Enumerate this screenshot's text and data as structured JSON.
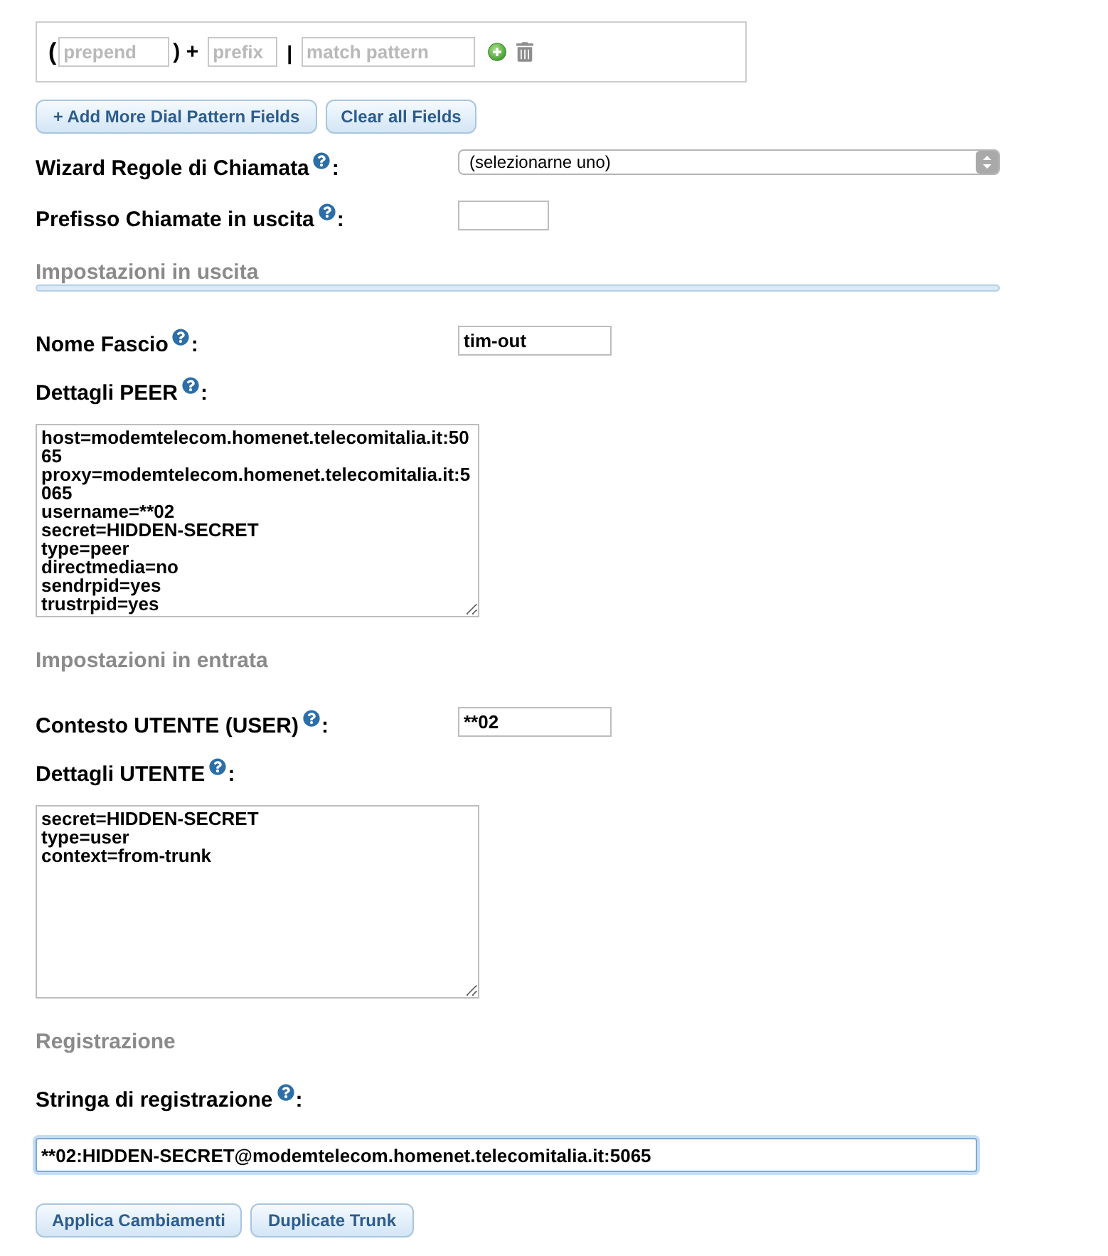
{
  "dial_pattern": {
    "open": "(",
    "prepend": {
      "placeholder": "prepend"
    },
    "plus": ") +",
    "prefix": {
      "placeholder": "prefix"
    },
    "separator": "|",
    "match": {
      "placeholder": "match pattern"
    }
  },
  "pattern_buttons": [
    "+ Add More Dial Pattern Fields",
    "Clear all Fields"
  ],
  "rows": [
    {
      "kind": "select",
      "label": "Wizard Regole di Chiamata",
      "colon": ":",
      "value": "(selezionarne uno)"
    },
    {
      "kind": "input",
      "label": "Prefisso Chiamate in uscita",
      "colon": ":",
      "focused": false
    },
    {
      "kind": "section",
      "title": "Impostazioni in uscita",
      "rule": true
    },
    {
      "kind": "input",
      "label": "Nome Fascio",
      "colon": ":",
      "value": "tim-out",
      "focused": false
    },
    {
      "kind": "textarea",
      "label": "Dettagli PEER",
      "colon": ":",
      "value": "host=modemtelecom.homenet.telecomitalia.it:5065\nproxy=modemtelecom.homenet.telecomitalia.it:5065\nusername=**02\nsecret=HIDDEN-SECRET\ntype=peer\ndirectmedia=no\nsendrpid=yes\ntrustrpid=yes",
      "focused": false
    },
    {
      "kind": "section",
      "title": "Impostazioni in entrata",
      "rule": false
    },
    {
      "kind": "input",
      "label": "Contesto UTENTE (USER)",
      "colon": ":",
      "value": "**02",
      "focused": false
    },
    {
      "kind": "textarea",
      "label": "Dettagli UTENTE",
      "colon": ":",
      "value": "secret=HIDDEN-SECRET\ntype=user\ncontext=from-trunk",
      "focused": false
    },
    {
      "kind": "section",
      "title": "Registrazione",
      "rule": false
    },
    {
      "kind": "wide_input",
      "label": "Stringa di registrazione",
      "colon": ":",
      "value": "**02:HIDDEN-SECRET@modemtelecom.homenet.telecomitalia.it:5065",
      "focused": true
    }
  ],
  "buttons": [
    "Applica Cambiamenti",
    "Duplicate Trunk"
  ]
}
